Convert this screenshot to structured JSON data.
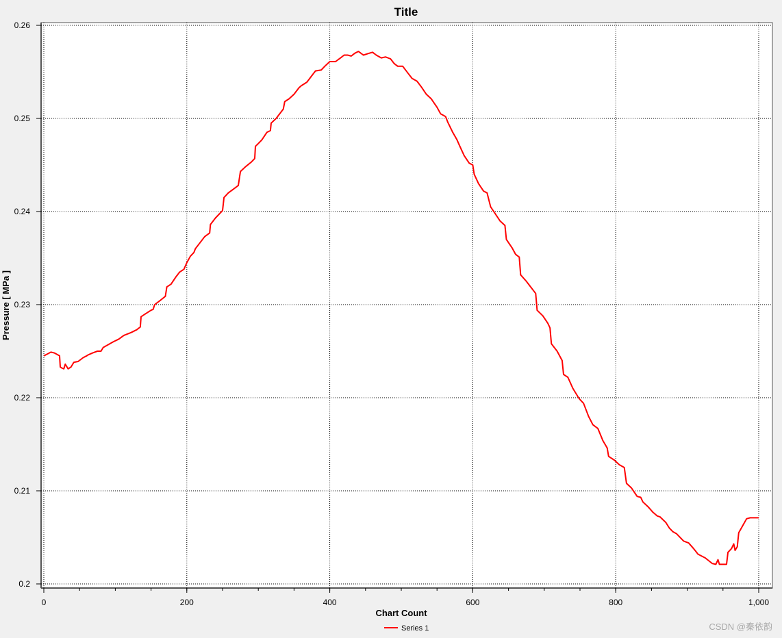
{
  "chart_data": {
    "type": "line",
    "title": "Title",
    "xlabel": "Chart Count",
    "ylabel": "Pressure [ MPa ]",
    "xlim": [
      0,
      1000
    ],
    "ylim": [
      0.2,
      0.26
    ],
    "x_ticks": [
      {
        "value": 0,
        "label": "0"
      },
      {
        "value": 200,
        "label": "200"
      },
      {
        "value": 400,
        "label": "400"
      },
      {
        "value": 600,
        "label": "600"
      },
      {
        "value": 800,
        "label": "800"
      },
      {
        "value": 1000,
        "label": "1,000"
      }
    ],
    "y_ticks": [
      {
        "value": 0.2,
        "label": "0.2"
      },
      {
        "value": 0.21,
        "label": "0.21"
      },
      {
        "value": 0.22,
        "label": "0.22"
      },
      {
        "value": 0.23,
        "label": "0.23"
      },
      {
        "value": 0.24,
        "label": "0.24"
      },
      {
        "value": 0.25,
        "label": "0.25"
      },
      {
        "value": 0.26,
        "label": "0.26"
      }
    ],
    "grid": true,
    "legend_position": "bottom-center",
    "series": [
      {
        "name": "Series 1",
        "color": "#ff0000",
        "points": [
          [
            0,
            0.2245
          ],
          [
            5,
            0.2247
          ],
          [
            10,
            0.2249
          ],
          [
            15,
            0.2248
          ],
          [
            22,
            0.2245
          ],
          [
            23,
            0.2233
          ],
          [
            25,
            0.2232
          ],
          [
            28,
            0.2231
          ],
          [
            30,
            0.2236
          ],
          [
            34,
            0.2231
          ],
          [
            38,
            0.2233
          ],
          [
            42,
            0.2238
          ],
          [
            48,
            0.2239
          ],
          [
            55,
            0.2243
          ],
          [
            60,
            0.2245
          ],
          [
            62,
            0.2246
          ],
          [
            68,
            0.2248
          ],
          [
            75,
            0.225
          ],
          [
            80,
            0.225
          ],
          [
            83,
            0.2254
          ],
          [
            90,
            0.2257
          ],
          [
            97,
            0.226
          ],
          [
            105,
            0.2263
          ],
          [
            112,
            0.2267
          ],
          [
            122,
            0.227
          ],
          [
            130,
            0.2273
          ],
          [
            135,
            0.2276
          ],
          [
            136,
            0.2287
          ],
          [
            142,
            0.229
          ],
          [
            150,
            0.2294
          ],
          [
            153,
            0.2295
          ],
          [
            155,
            0.23
          ],
          [
            162,
            0.2304
          ],
          [
            170,
            0.2309
          ],
          [
            172,
            0.2319
          ],
          [
            178,
            0.2322
          ],
          [
            185,
            0.233
          ],
          [
            190,
            0.2335
          ],
          [
            196,
            0.2338
          ],
          [
            200,
            0.2345
          ],
          [
            205,
            0.2352
          ],
          [
            210,
            0.2356
          ],
          [
            212,
            0.236
          ],
          [
            218,
            0.2366
          ],
          [
            225,
            0.2373
          ],
          [
            232,
            0.2377
          ],
          [
            233,
            0.2386
          ],
          [
            240,
            0.2393
          ],
          [
            250,
            0.2401
          ],
          [
            252,
            0.2415
          ],
          [
            258,
            0.242
          ],
          [
            265,
            0.2424
          ],
          [
            272,
            0.2428
          ],
          [
            275,
            0.2443
          ],
          [
            282,
            0.2448
          ],
          [
            290,
            0.2453
          ],
          [
            295,
            0.2457
          ],
          [
            296,
            0.247
          ],
          [
            300,
            0.2473
          ],
          [
            305,
            0.2477
          ],
          [
            312,
            0.2485
          ],
          [
            317,
            0.2487
          ],
          [
            318,
            0.2495
          ],
          [
            325,
            0.25
          ],
          [
            335,
            0.251
          ],
          [
            337,
            0.2518
          ],
          [
            343,
            0.2521
          ],
          [
            350,
            0.2526
          ],
          [
            357,
            0.2533
          ],
          [
            360,
            0.2535
          ],
          [
            368,
            0.2539
          ],
          [
            375,
            0.2546
          ],
          [
            380,
            0.2551
          ],
          [
            388,
            0.2552
          ],
          [
            393,
            0.2556
          ],
          [
            400,
            0.2561
          ],
          [
            408,
            0.2561
          ],
          [
            415,
            0.2565
          ],
          [
            420,
            0.2568
          ],
          [
            425,
            0.2568
          ],
          [
            430,
            0.2567
          ],
          [
            435,
            0.257
          ],
          [
            440,
            0.2572
          ],
          [
            447,
            0.2568
          ],
          [
            455,
            0.257
          ],
          [
            460,
            0.2571
          ],
          [
            465,
            0.2568
          ],
          [
            472,
            0.2565
          ],
          [
            478,
            0.2566
          ],
          [
            485,
            0.2564
          ],
          [
            490,
            0.2559
          ],
          [
            495,
            0.2556
          ],
          [
            502,
            0.2556
          ],
          [
            510,
            0.2548
          ],
          [
            515,
            0.2543
          ],
          [
            522,
            0.254
          ],
          [
            528,
            0.2534
          ],
          [
            535,
            0.2526
          ],
          [
            542,
            0.2521
          ],
          [
            550,
            0.2512
          ],
          [
            555,
            0.2505
          ],
          [
            562,
            0.2502
          ],
          [
            565,
            0.2496
          ],
          [
            572,
            0.2485
          ],
          [
            578,
            0.2477
          ],
          [
            582,
            0.247
          ],
          [
            588,
            0.246
          ],
          [
            595,
            0.2452
          ],
          [
            600,
            0.245
          ],
          [
            602,
            0.244
          ],
          [
            608,
            0.243
          ],
          [
            615,
            0.2422
          ],
          [
            620,
            0.242
          ],
          [
            625,
            0.2405
          ],
          [
            632,
            0.2397
          ],
          [
            638,
            0.239
          ],
          [
            645,
            0.2385
          ],
          [
            647,
            0.237
          ],
          [
            655,
            0.2361
          ],
          [
            660,
            0.2354
          ],
          [
            665,
            0.2351
          ],
          [
            667,
            0.2332
          ],
          [
            675,
            0.2325
          ],
          [
            682,
            0.2318
          ],
          [
            688,
            0.2312
          ],
          [
            690,
            0.2294
          ],
          [
            698,
            0.2288
          ],
          [
            705,
            0.228
          ],
          [
            708,
            0.2275
          ],
          [
            710,
            0.2258
          ],
          [
            718,
            0.225
          ],
          [
            725,
            0.224
          ],
          [
            727,
            0.2225
          ],
          [
            733,
            0.2222
          ],
          [
            740,
            0.221
          ],
          [
            748,
            0.22
          ],
          [
            750,
            0.2198
          ],
          [
            755,
            0.2194
          ],
          [
            762,
            0.218
          ],
          [
            768,
            0.2171
          ],
          [
            775,
            0.2167
          ],
          [
            782,
            0.2154
          ],
          [
            788,
            0.2146
          ],
          [
            790,
            0.2137
          ],
          [
            798,
            0.2133
          ],
          [
            805,
            0.2128
          ],
          [
            812,
            0.2125
          ],
          [
            815,
            0.2108
          ],
          [
            822,
            0.2103
          ],
          [
            830,
            0.2094
          ],
          [
            835,
            0.2093
          ],
          [
            838,
            0.2088
          ],
          [
            845,
            0.2083
          ],
          [
            852,
            0.2077
          ],
          [
            858,
            0.2073
          ],
          [
            862,
            0.2072
          ],
          [
            870,
            0.2066
          ],
          [
            875,
            0.206
          ],
          [
            880,
            0.2056
          ],
          [
            885,
            0.2054
          ],
          [
            895,
            0.2046
          ],
          [
            902,
            0.2044
          ],
          [
            910,
            0.2037
          ],
          [
            915,
            0.2032
          ],
          [
            920,
            0.203
          ],
          [
            925,
            0.2028
          ],
          [
            935,
            0.2022
          ],
          [
            940,
            0.2021
          ],
          [
            943,
            0.2026
          ],
          [
            945,
            0.2021
          ],
          [
            955,
            0.2021
          ],
          [
            957,
            0.2034
          ],
          [
            962,
            0.2038
          ],
          [
            965,
            0.2043
          ],
          [
            967,
            0.2036
          ],
          [
            970,
            0.204
          ],
          [
            972,
            0.2055
          ],
          [
            978,
            0.2063
          ],
          [
            983,
            0.207
          ],
          [
            988,
            0.2071
          ],
          [
            1000,
            0.2071
          ]
        ]
      }
    ]
  },
  "watermark": "CSDN @秦依韵"
}
